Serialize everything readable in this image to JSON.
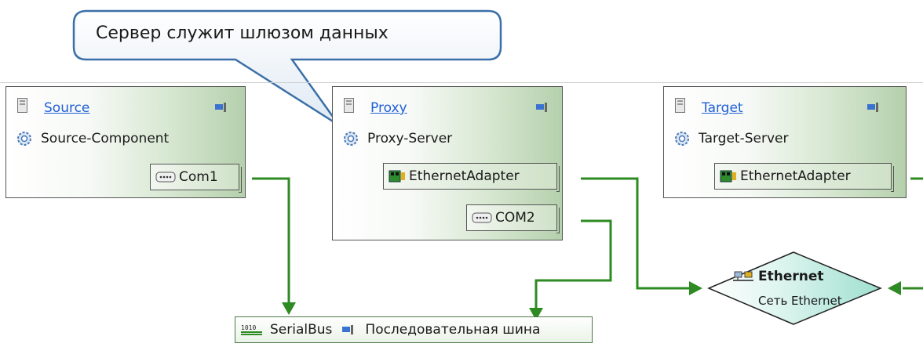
{
  "callout": {
    "text": "Сервер служит шлюзом данных"
  },
  "nodes": {
    "source": {
      "title": "Source",
      "component": "Source-Component",
      "port": "Com1"
    },
    "proxy": {
      "title": "Proxy",
      "component": "Proxy-Server",
      "port_ethernet": "EthernetAdapter",
      "port_com": "COM2"
    },
    "target": {
      "title": "Target",
      "component": "Target-Server",
      "port": "EthernetAdapter"
    }
  },
  "bus": {
    "name": "SerialBus",
    "description": "Последовательная шина"
  },
  "ethernet": {
    "name": "Ethernet",
    "description": "Сеть Ethernet"
  },
  "colors": {
    "link": "#1f5fd8",
    "connector": "#2e8a22",
    "callout_border": "#3a6fa8"
  },
  "icons": [
    "server-icon",
    "dock-icon",
    "gear-icon",
    "serial-port-icon",
    "network-card-icon",
    "bus-icon",
    "network-icon"
  ]
}
